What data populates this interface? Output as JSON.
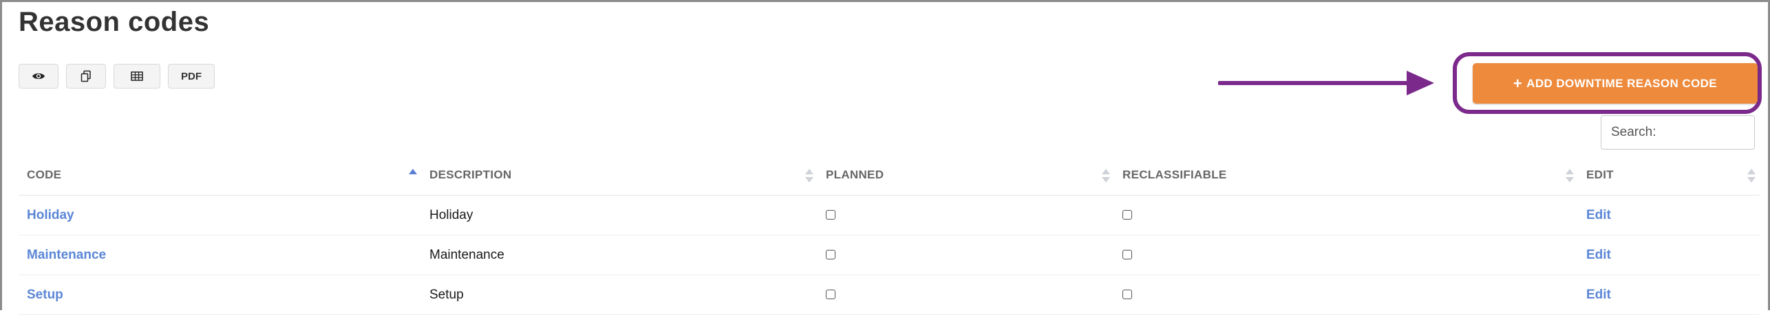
{
  "page": {
    "title": "Reason codes"
  },
  "toolbar": {
    "buttons": [
      {
        "icon": "eye-icon",
        "label": ""
      },
      {
        "icon": "copy-icon",
        "label": ""
      },
      {
        "icon": "table-icon",
        "label": ""
      },
      {
        "icon": "pdf",
        "label": "PDF"
      }
    ]
  },
  "actions": {
    "add_label": "ADD DOWNTIME REASON CODE",
    "add_icon": "+",
    "highlight_color": "#7b2a8b",
    "button_color": "#ee8a3c"
  },
  "search": {
    "placeholder": "Search:",
    "value": ""
  },
  "table": {
    "columns": [
      "CODE",
      "DESCRIPTION",
      "PLANNED",
      "RECLASSIFIABLE",
      "EDIT"
    ],
    "sorted_column": "CODE",
    "rows": [
      {
        "code": "Holiday",
        "description": "Holiday",
        "planned": false,
        "reclassifiable": false,
        "edit": "Edit"
      },
      {
        "code": "Maintenance",
        "description": "Maintenance",
        "planned": false,
        "reclassifiable": false,
        "edit": "Edit"
      },
      {
        "code": "Setup",
        "description": "Setup",
        "planned": false,
        "reclassifiable": false,
        "edit": "Edit"
      }
    ]
  }
}
